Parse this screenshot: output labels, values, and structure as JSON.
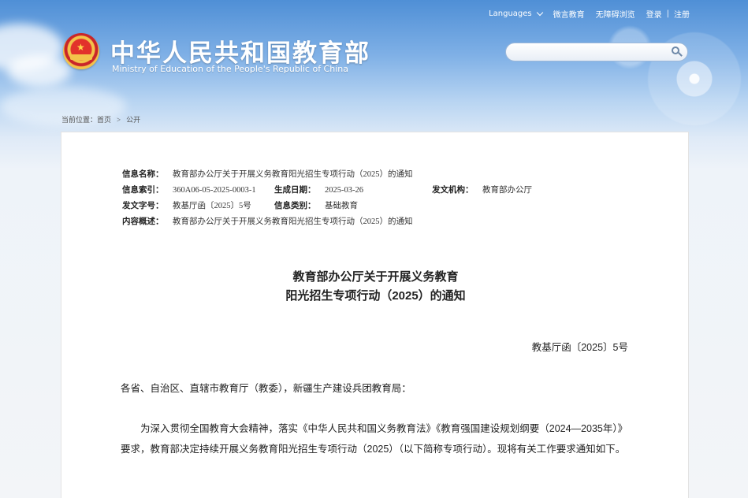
{
  "header": {
    "languages_label": "Languages",
    "wechat_label": "微言教育",
    "accessibility_label": "无障碍浏览",
    "login_label": "登录",
    "link_separator": "|",
    "register_label": "注册",
    "site_title": "中华人民共和国教育部",
    "site_subtitle": "Ministry of Education of the People's Republic of China",
    "search_value": ""
  },
  "breadcrumb": {
    "prefix": "当前位置：",
    "home": "首页",
    "arrow": ">",
    "current": "公开"
  },
  "meta": {
    "name_label": "信息名称：",
    "name_value": "教育部办公厅关于开展义务教育阳光招生专项行动（2025）的通知",
    "index_label": "信息索引：",
    "index_value": "360A06-05-2025-0003-1",
    "date_label": "生成日期：",
    "date_value": "2025-03-26",
    "org_label": "发文机构：",
    "org_value": "教育部办公厅",
    "docno_label": "发文字号：",
    "docno_value": "教基厅函〔2025〕5号",
    "category_label": "信息类别：",
    "category_value": "基础教育",
    "summary_label": "内容概述：",
    "summary_value": "教育部办公厅关于开展义务教育阳光招生专项行动（2025）的通知"
  },
  "document": {
    "title_line1": "教育部办公厅关于开展义务教育",
    "title_line2": "阳光招生专项行动（2025）的通知",
    "number": "教基厅函〔2025〕5号",
    "addressee": "各省、自治区、直辖市教育厅（教委），新疆生产建设兵团教育局：",
    "paragraph1": "为深入贯彻全国教育大会精神，落实《中华人民共和国义务教育法》《教育强国建设规划纲要（2024—2035年）》要求，教育部决定持续开展义务教育阳光招生专项行动（2025）（以下简称专项行动）。现将有关工作要求通知如下。"
  },
  "colors": {
    "sky_top": "#4f8fd6",
    "page_bg": "#f3f5f8",
    "emblem_red": "#e2322b",
    "emblem_gold": "#f3c34a",
    "text": "#222222"
  }
}
